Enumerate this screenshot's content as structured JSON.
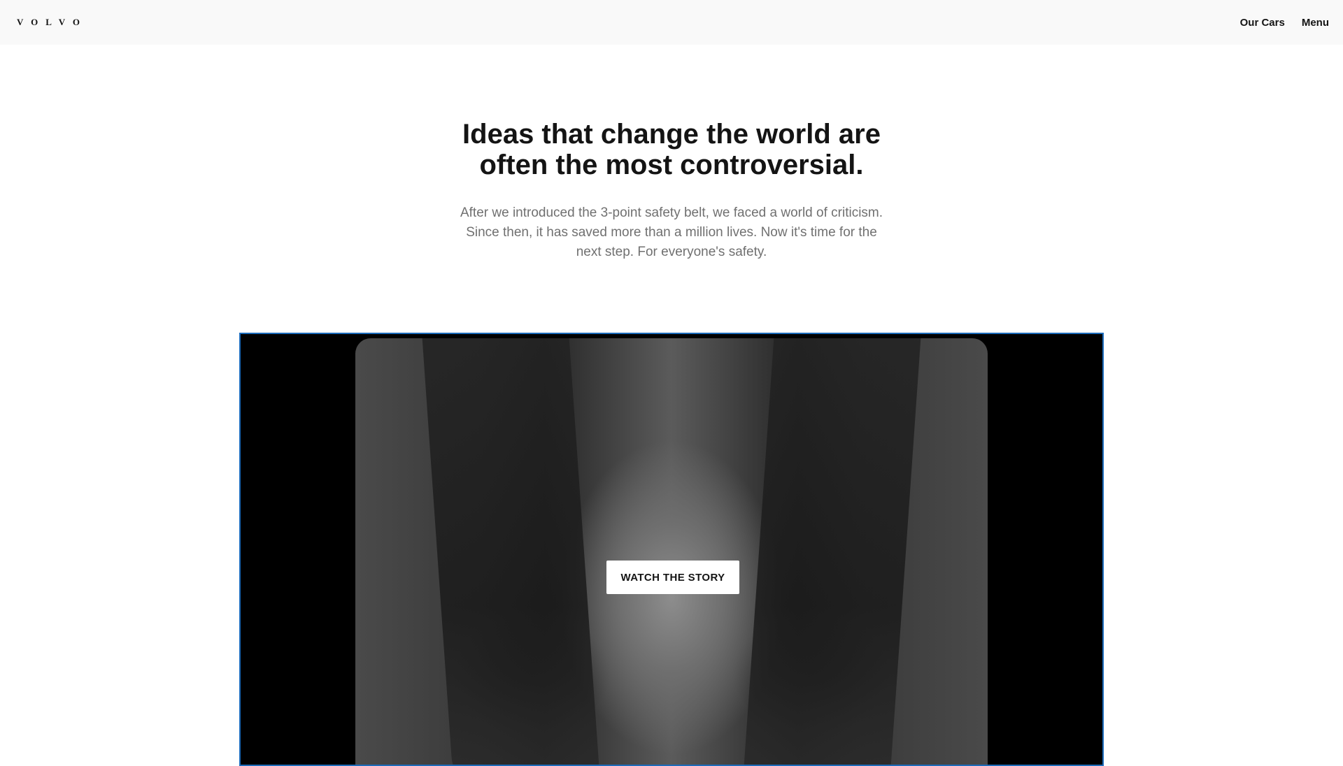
{
  "header": {
    "logo": "VOLVO",
    "nav": [
      "Our Cars",
      "Menu"
    ]
  },
  "hero": {
    "headline": "Ideas that change the world are often the most controversial.",
    "lede": "After we introduced the 3-point safety belt, we faced a world of criticism. Since then, it has saved more than a million lives. Now it's time for the next step. For everyone's safety."
  },
  "video": {
    "cta_label": "WATCH THE STORY"
  },
  "colors": {
    "text": "#141414",
    "muted": "#707070",
    "header_bg": "#f9f9f9",
    "focus_outline": "#1c6bba"
  }
}
